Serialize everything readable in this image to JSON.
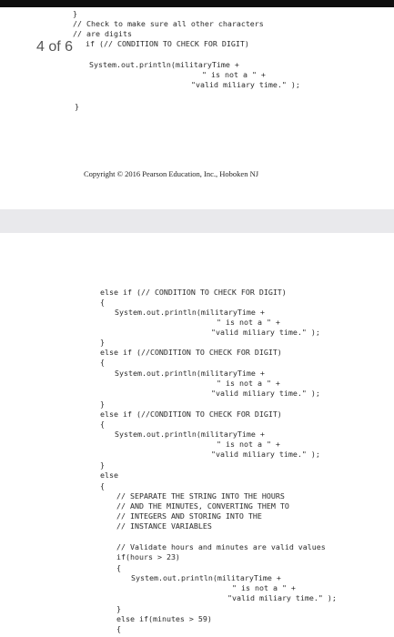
{
  "viewer": {
    "page_counter": "4 of 6"
  },
  "page1": {
    "lines": [
      "}",
      "// Check to make sure all other characters",
      "// are digits",
      "if (// CONDITION TO CHECK FOR DIGIT)",
      "System.out.println(militaryTime +",
      "\" is not a \" +",
      "\"valid miliary time.\" );",
      "}"
    ],
    "copyright": "Copyright © 2016 Pearson Education, Inc., Hoboken NJ"
  },
  "page2": {
    "lines": [
      "else if (// CONDITION TO CHECK FOR DIGIT)",
      "{",
      "System.out.println(militaryTime +",
      "\" is not a \" +",
      "\"valid miliary time.\" );",
      "}",
      "else if (//CONDITION TO CHECK FOR DIGIT)",
      "{",
      "System.out.println(militaryTime +",
      "\" is not a \" +",
      "\"valid miliary time.\" );",
      "}",
      "else if (//CONDITION TO CHECK FOR DIGIT)",
      "{",
      "System.out.println(militaryTime +",
      "\" is not a \" +",
      "\"valid miliary time.\" );",
      "}",
      "else",
      "{",
      "// SEPARATE THE STRING INTO THE HOURS",
      "// AND THE MINUTES, CONVERTING THEM TO",
      "// INTEGERS AND STORING INTO THE",
      "// INSTANCE VARIABLES",
      "// Validate hours and minutes are valid values",
      "if(hours > 23)",
      "{",
      "System.out.println(militaryTime +",
      "\" is not a \" +",
      "\"valid miliary time.\" );",
      "}",
      "else if(minutes > 59)",
      "{"
    ]
  }
}
